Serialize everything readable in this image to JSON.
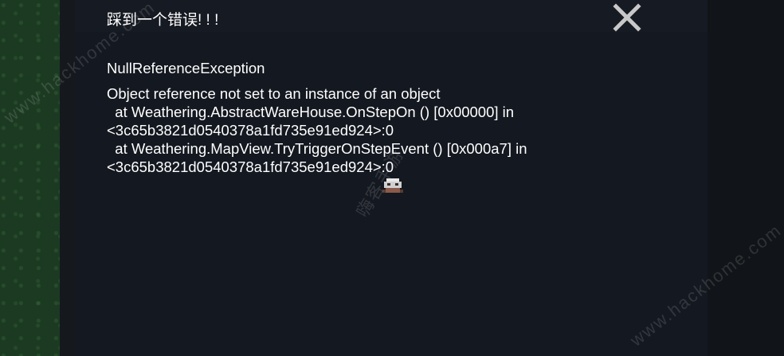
{
  "dialog": {
    "title": "踩到一个错误! ! !",
    "error_type": "NullReferenceException",
    "trace_lines": [
      "Object reference not set to an instance of an object",
      "  at Weathering.AbstractWareHouse.OnStepOn () [0x00000] in",
      "<3c65b3821d0540378a1fd735e91ed924>:0",
      "  at Weathering.MapView.TryTriggerOnStepEvent () [0x000a7] in",
      "<3c65b3821d0540378a1fd735e91ed924>:0"
    ]
  },
  "watermarks": {
    "site": "www.hackhome.com",
    "brand": "嗨客手游"
  },
  "colors": {
    "dialog_bg": "#141820",
    "text": "#ffffff",
    "close_icon": "#c8c8c8",
    "grass": "#1c3a22"
  },
  "icons": {
    "close": "close-x-icon"
  }
}
